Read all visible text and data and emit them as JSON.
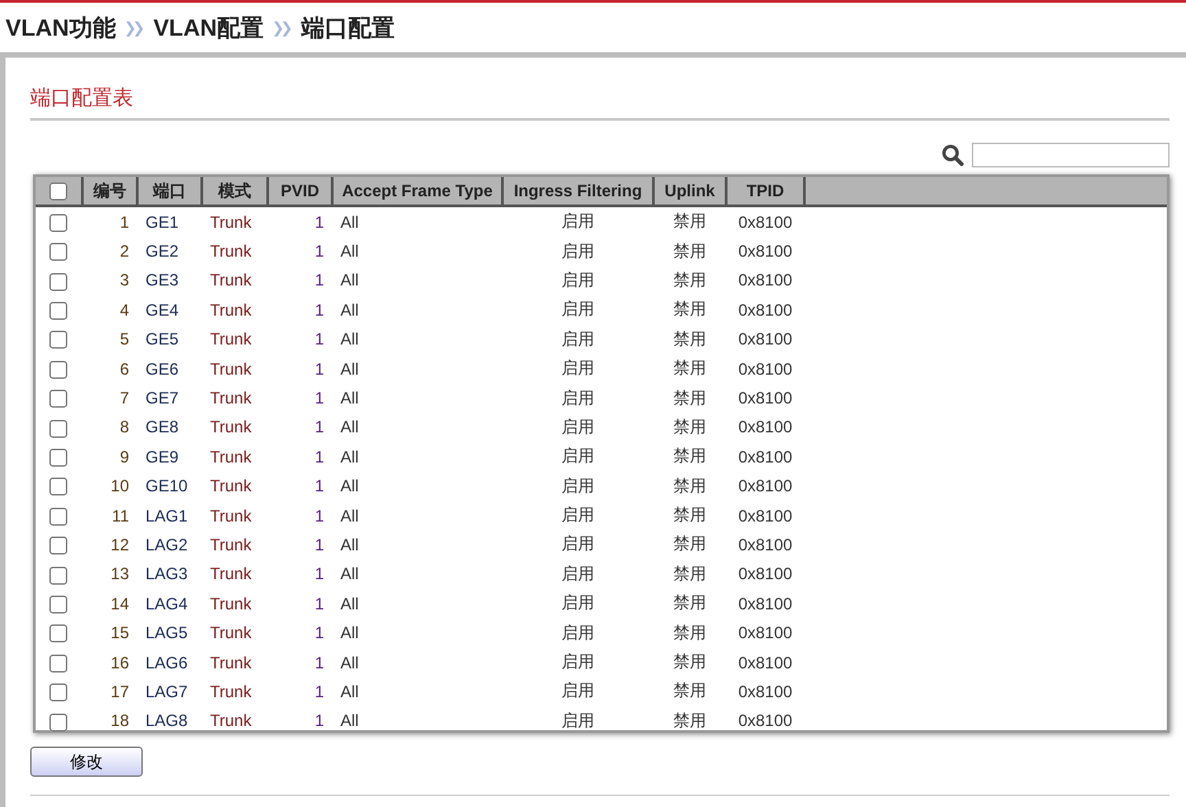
{
  "breadcrumb": [
    "VLAN功能",
    "VLAN配置",
    "端口配置"
  ],
  "breadcrumb_separator": "❯❯",
  "section_title": "端口配置表",
  "table": {
    "select_all": {
      "checked": false
    },
    "columns": [
      "编号",
      "端口",
      "模式",
      "PVID",
      "Accept Frame Type",
      "Ingress Filtering",
      "Uplink",
      "TPID"
    ],
    "rows": [
      {
        "checked": false,
        "cells": [
          "1",
          "GE1",
          "Trunk",
          "1",
          "All",
          "启用",
          "禁用",
          "0x8100"
        ]
      },
      {
        "checked": false,
        "cells": [
          "2",
          "GE2",
          "Trunk",
          "1",
          "All",
          "启用",
          "禁用",
          "0x8100"
        ]
      },
      {
        "checked": false,
        "cells": [
          "3",
          "GE3",
          "Trunk",
          "1",
          "All",
          "启用",
          "禁用",
          "0x8100"
        ]
      },
      {
        "checked": false,
        "cells": [
          "4",
          "GE4",
          "Trunk",
          "1",
          "All",
          "启用",
          "禁用",
          "0x8100"
        ]
      },
      {
        "checked": false,
        "cells": [
          "5",
          "GE5",
          "Trunk",
          "1",
          "All",
          "启用",
          "禁用",
          "0x8100"
        ]
      },
      {
        "checked": false,
        "cells": [
          "6",
          "GE6",
          "Trunk",
          "1",
          "All",
          "启用",
          "禁用",
          "0x8100"
        ]
      },
      {
        "checked": false,
        "cells": [
          "7",
          "GE7",
          "Trunk",
          "1",
          "All",
          "启用",
          "禁用",
          "0x8100"
        ]
      },
      {
        "checked": false,
        "cells": [
          "8",
          "GE8",
          "Trunk",
          "1",
          "All",
          "启用",
          "禁用",
          "0x8100"
        ]
      },
      {
        "checked": false,
        "cells": [
          "9",
          "GE9",
          "Trunk",
          "1",
          "All",
          "启用",
          "禁用",
          "0x8100"
        ]
      },
      {
        "checked": false,
        "cells": [
          "10",
          "GE10",
          "Trunk",
          "1",
          "All",
          "启用",
          "禁用",
          "0x8100"
        ]
      },
      {
        "checked": false,
        "cells": [
          "11",
          "LAG1",
          "Trunk",
          "1",
          "All",
          "启用",
          "禁用",
          "0x8100"
        ]
      },
      {
        "checked": false,
        "cells": [
          "12",
          "LAG2",
          "Trunk",
          "1",
          "All",
          "启用",
          "禁用",
          "0x8100"
        ]
      },
      {
        "checked": false,
        "cells": [
          "13",
          "LAG3",
          "Trunk",
          "1",
          "All",
          "启用",
          "禁用",
          "0x8100"
        ]
      },
      {
        "checked": false,
        "cells": [
          "14",
          "LAG4",
          "Trunk",
          "1",
          "All",
          "启用",
          "禁用",
          "0x8100"
        ]
      },
      {
        "checked": false,
        "cells": [
          "15",
          "LAG5",
          "Trunk",
          "1",
          "All",
          "启用",
          "禁用",
          "0x8100"
        ]
      },
      {
        "checked": false,
        "cells": [
          "16",
          "LAG6",
          "Trunk",
          "1",
          "All",
          "启用",
          "禁用",
          "0x8100"
        ]
      },
      {
        "checked": false,
        "cells": [
          "17",
          "LAG7",
          "Trunk",
          "1",
          "All",
          "启用",
          "禁用",
          "0x8100"
        ]
      },
      {
        "checked": false,
        "cells": [
          "18",
          "LAG8",
          "Trunk",
          "1",
          "All",
          "启用",
          "禁用",
          "0x8100"
        ]
      }
    ]
  },
  "buttons": [
    "修改"
  ]
}
